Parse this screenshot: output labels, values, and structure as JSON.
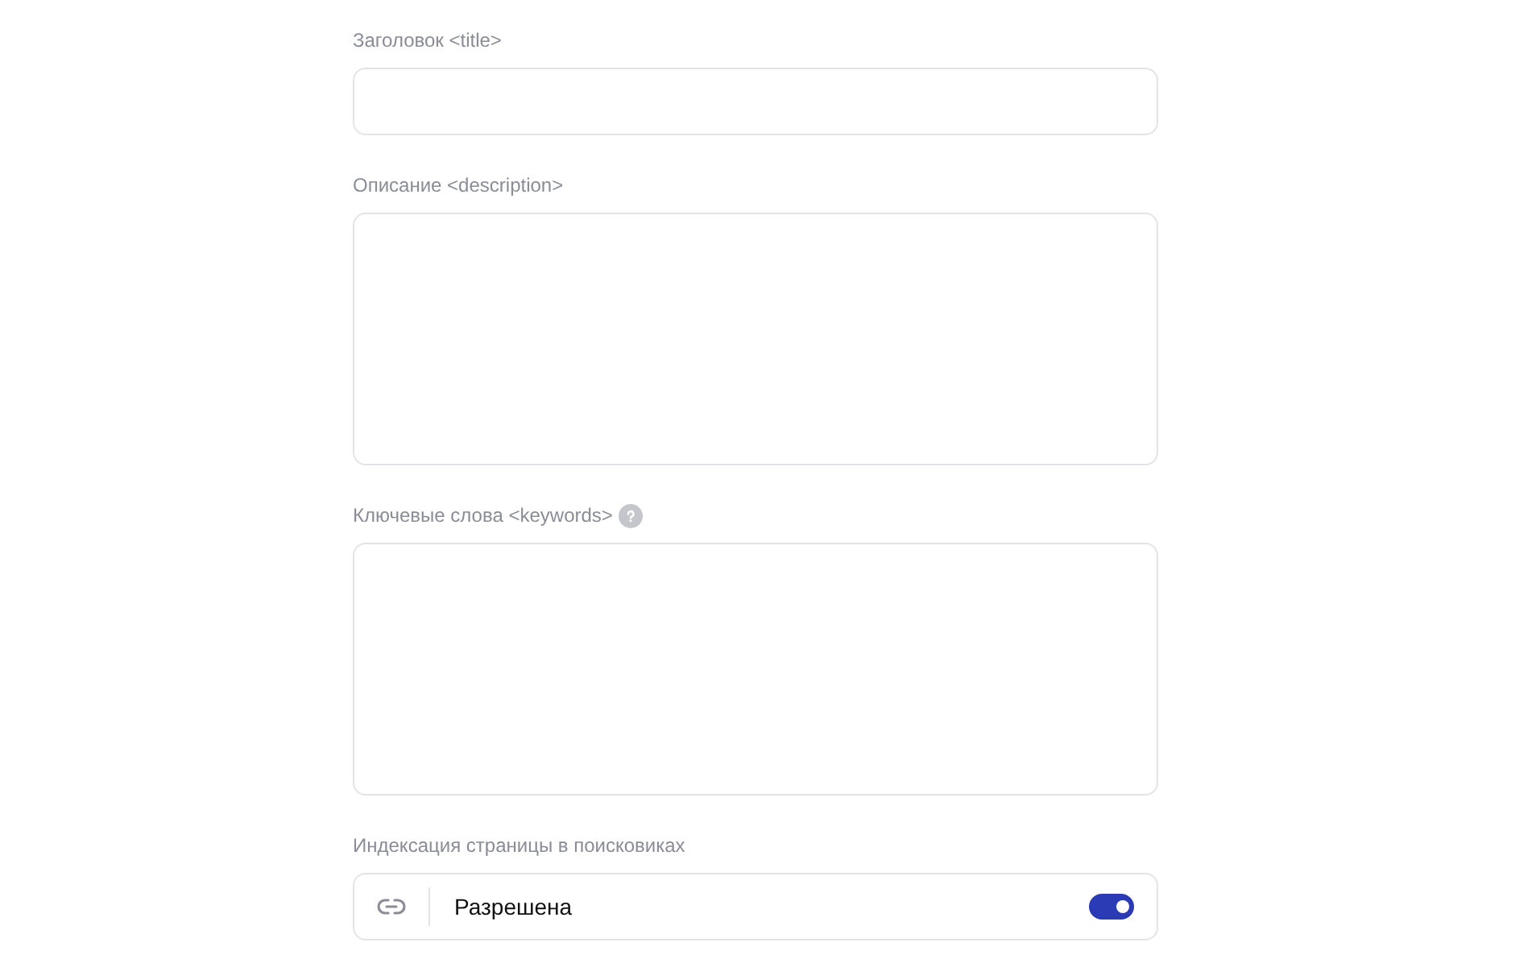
{
  "fields": [
    {
      "kind": "input",
      "label": "Заголовок <title>",
      "help": false
    },
    {
      "kind": "textarea",
      "label": "Описание <description>",
      "help": false
    },
    {
      "kind": "textarea",
      "label": "Ключевые слова <keywords>",
      "help": true
    }
  ],
  "indexing": {
    "label": "Индексация страницы в поисковиках",
    "value": "Разрешена",
    "on": true
  }
}
